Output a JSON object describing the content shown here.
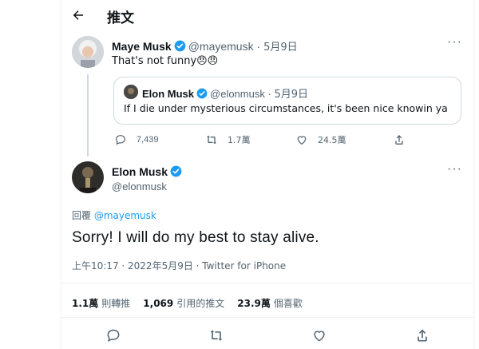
{
  "header": {
    "title": "推文"
  },
  "parent_tweet": {
    "author_name": "Maye Musk",
    "handle": "@mayemusk",
    "separator": "·",
    "date": "5月9日",
    "text": "That's not funny😠😠",
    "quoted": {
      "author_name": "Elon Musk",
      "handle": "@elonmusk",
      "separator": "·",
      "date": "5月9日",
      "text": "If I die under mysterious circumstances, it's been nice knowin ya"
    },
    "actions": {
      "replies": "7,439",
      "retweets": "1.7萬",
      "likes": "24.5萬"
    }
  },
  "main_tweet": {
    "author_name": "Elon Musk",
    "handle": "@elonmusk",
    "reply_prefix": "回覆",
    "reply_to": "@mayemusk",
    "text": "Sorry! I will do my best to stay alive.",
    "meta": "上午10:17 · 2022年5月9日 · Twitter for iPhone",
    "stats": {
      "retweets_value": "1.1萬",
      "retweets_label": "則轉推",
      "quotes_value": "1,069",
      "quotes_label": "引用的推文",
      "likes_value": "23.9萬",
      "likes_label": "個喜歡"
    }
  },
  "colors": {
    "accent": "#1d9bf0",
    "muted": "#536471",
    "text": "#0f1419",
    "border": "#eff3f4"
  }
}
